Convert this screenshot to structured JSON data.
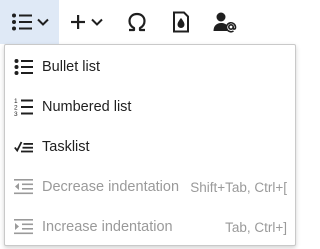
{
  "toolbar": {
    "buttons": [
      {
        "name": "lists-dropdown-button",
        "icon": "bullet-list-icon",
        "has_chevron": true,
        "active": true
      },
      {
        "name": "insert-dropdown-button",
        "icon": "plus-icon",
        "has_chevron": true,
        "active": false
      },
      {
        "name": "special-character-button",
        "icon": "omega-icon",
        "has_chevron": false,
        "active": false
      },
      {
        "name": "bookmark-button",
        "icon": "bookmark-drop-icon",
        "has_chevron": false,
        "active": false
      },
      {
        "name": "mention-button",
        "icon": "user-at-icon",
        "has_chevron": false,
        "active": false
      }
    ]
  },
  "menu": {
    "items": [
      {
        "label": "Bullet list",
        "shortcut": "",
        "icon": "bullet-list-icon",
        "disabled": false
      },
      {
        "label": "Numbered list",
        "shortcut": "",
        "icon": "numbered-list-icon",
        "disabled": false
      },
      {
        "label": "Tasklist",
        "shortcut": "",
        "icon": "tasklist-icon",
        "disabled": false
      },
      {
        "label": "Decrease indentation",
        "shortcut": "Shift+Tab, Ctrl+[",
        "icon": "outdent-icon",
        "disabled": true
      },
      {
        "label": "Increase indentation",
        "shortcut": "Tab, Ctrl+]",
        "icon": "indent-icon",
        "disabled": true
      }
    ]
  },
  "colors": {
    "active_button_bg": "#dfe9f6",
    "text": "#1f1f1f",
    "disabled_text": "#9a9a9a",
    "menu_border": "#c9c9c9"
  }
}
